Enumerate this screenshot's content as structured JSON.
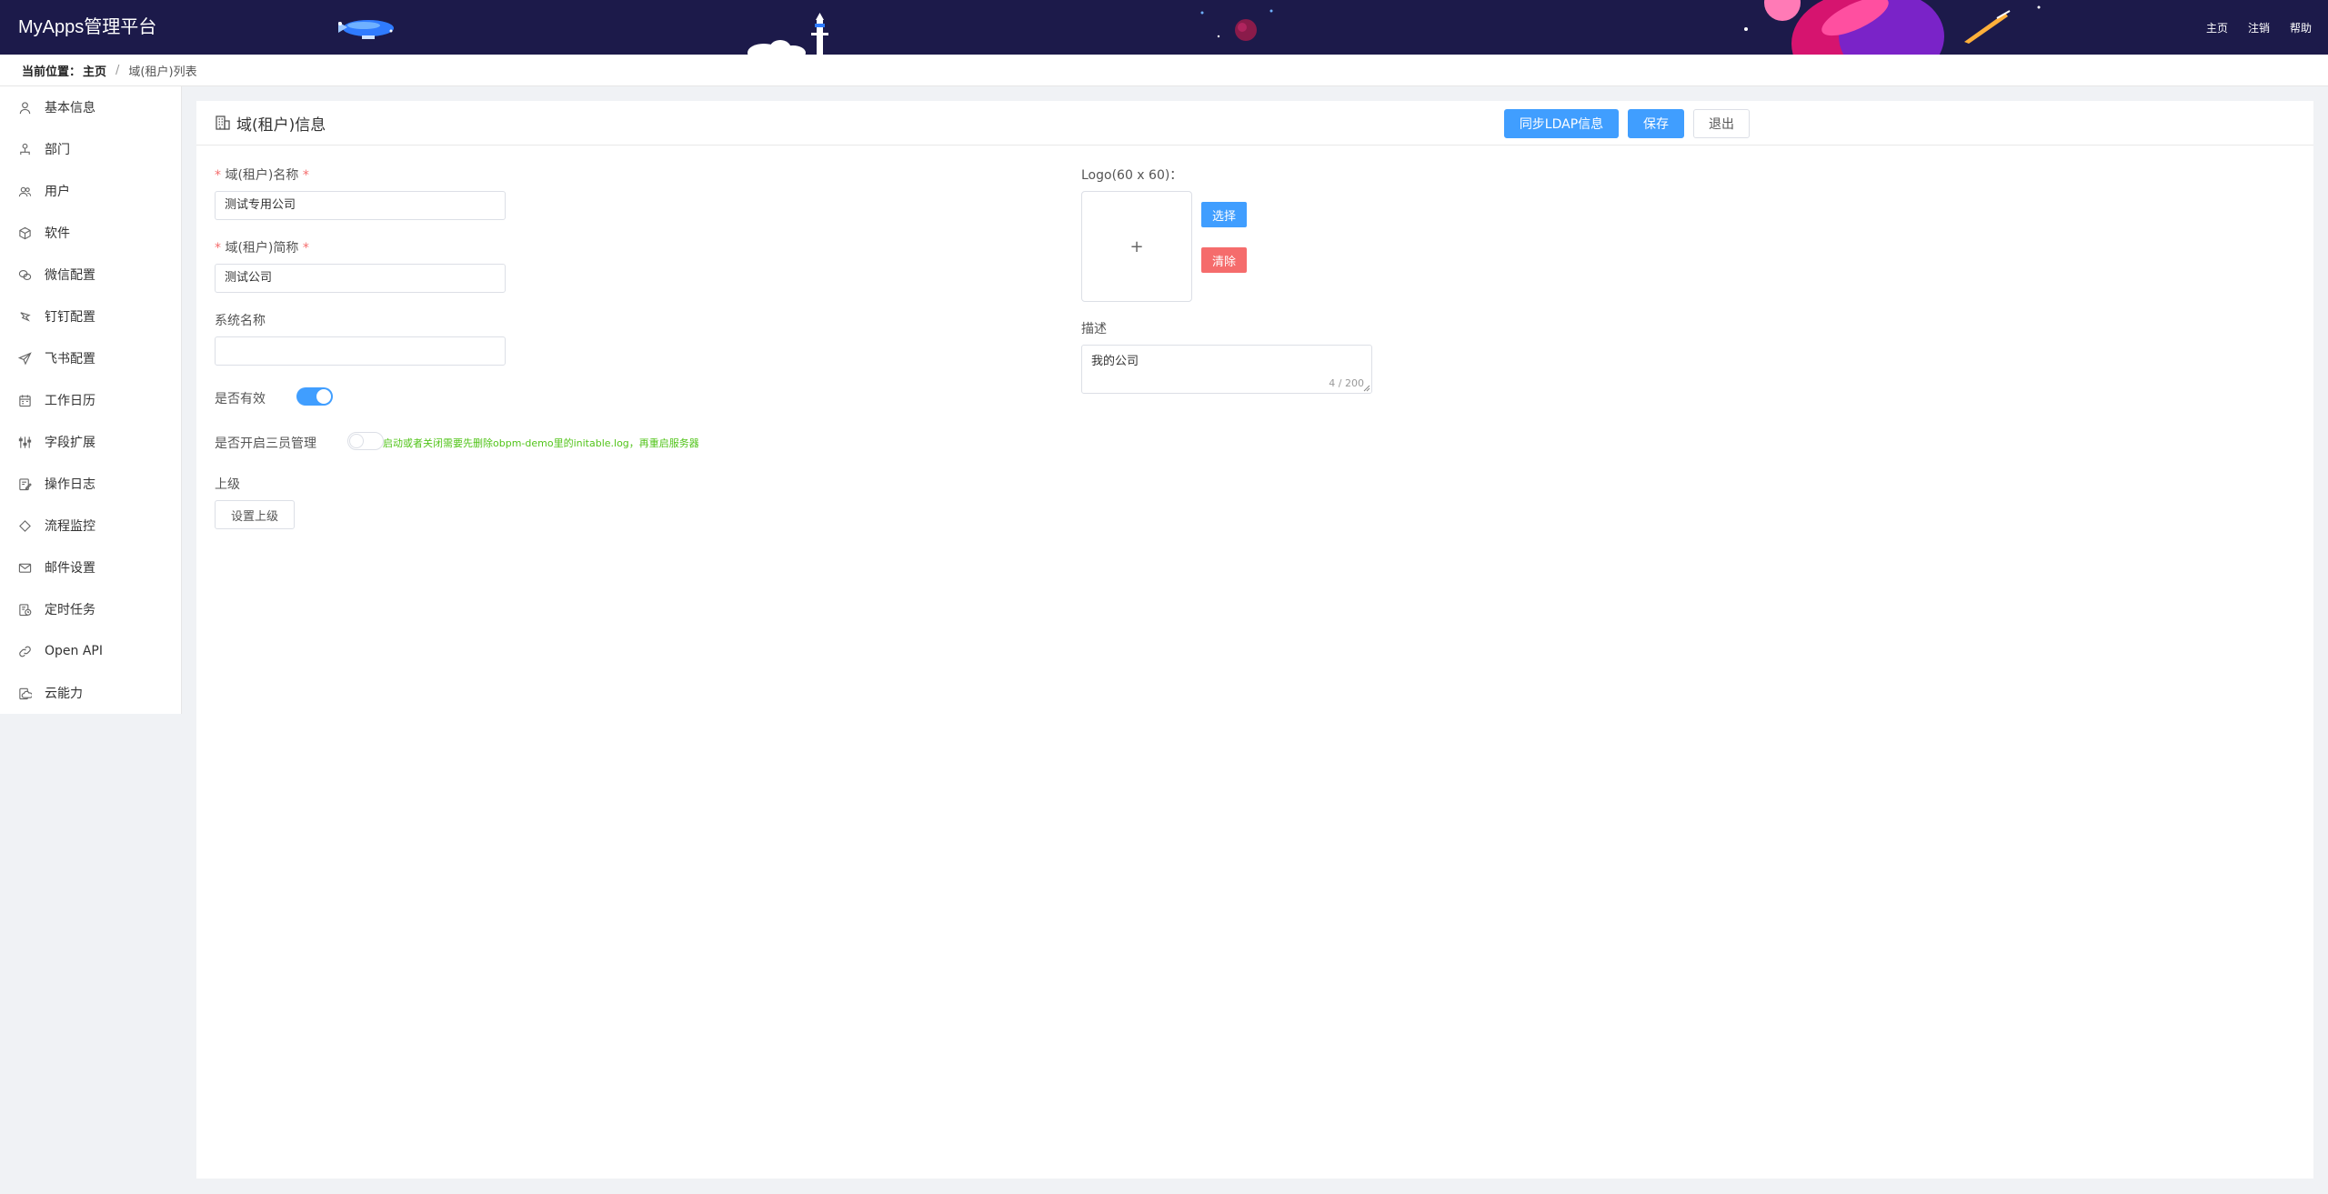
{
  "app": {
    "title": "MyApps管理平台"
  },
  "topnav": {
    "home": "主页",
    "logout": "注销",
    "help": "帮助"
  },
  "breadcrumb": {
    "label": "当前位置：",
    "home": "主页",
    "separator": "/",
    "current": "域(租户)列表"
  },
  "sidebar": {
    "items": [
      {
        "label": "基本信息",
        "icon": "user-outline-icon"
      },
      {
        "label": "部门",
        "icon": "org-tree-icon"
      },
      {
        "label": "用户",
        "icon": "users-icon"
      },
      {
        "label": "软件",
        "icon": "cube-icon"
      },
      {
        "label": "微信配置",
        "icon": "wechat-icon"
      },
      {
        "label": "钉钉配置",
        "icon": "dingtalk-icon"
      },
      {
        "label": "飞书配置",
        "icon": "paper-plane-icon"
      },
      {
        "label": "工作日历",
        "icon": "calendar-icon"
      },
      {
        "label": "字段扩展",
        "icon": "sliders-icon"
      },
      {
        "label": "操作日志",
        "icon": "log-edit-icon"
      },
      {
        "label": "流程监控",
        "icon": "diamond-icon"
      },
      {
        "label": "邮件设置",
        "icon": "mail-icon"
      },
      {
        "label": "定时任务",
        "icon": "schedule-icon"
      },
      {
        "label": "Open API",
        "icon": "link-icon"
      },
      {
        "label": "云能力",
        "icon": "cloud-icon"
      }
    ]
  },
  "panel": {
    "title": "域(租户)信息",
    "buttons": {
      "sync_ldap": "同步LDAP信息",
      "save": "保存",
      "exit": "退出"
    }
  },
  "form": {
    "name": {
      "label": "域(租户)名称",
      "value": "测试专用公司"
    },
    "short_name": {
      "label": "域(租户)简称",
      "value": "测试公司"
    },
    "system_name": {
      "label": "系统名称",
      "value": ""
    },
    "active": {
      "label": "是否有效",
      "on": true
    },
    "three_admins": {
      "label": "是否开启三员管理",
      "on": false,
      "hint": "启动或者关闭需要先删除obpm-demo里的initable.log，再重启服务器"
    },
    "parent": {
      "label": "上级",
      "button": "设置上级"
    },
    "logo": {
      "label": "Logo(60 x 60)：",
      "placeholder": "+",
      "choose": "选择",
      "clear": "清除"
    },
    "description": {
      "label": "描述",
      "value": "我的公司",
      "count": "4 / 200"
    }
  },
  "colors": {
    "header_bg": "#1c1a4a",
    "primary": "#409eff",
    "danger": "#f56c6c",
    "success_text": "#52c41a"
  }
}
